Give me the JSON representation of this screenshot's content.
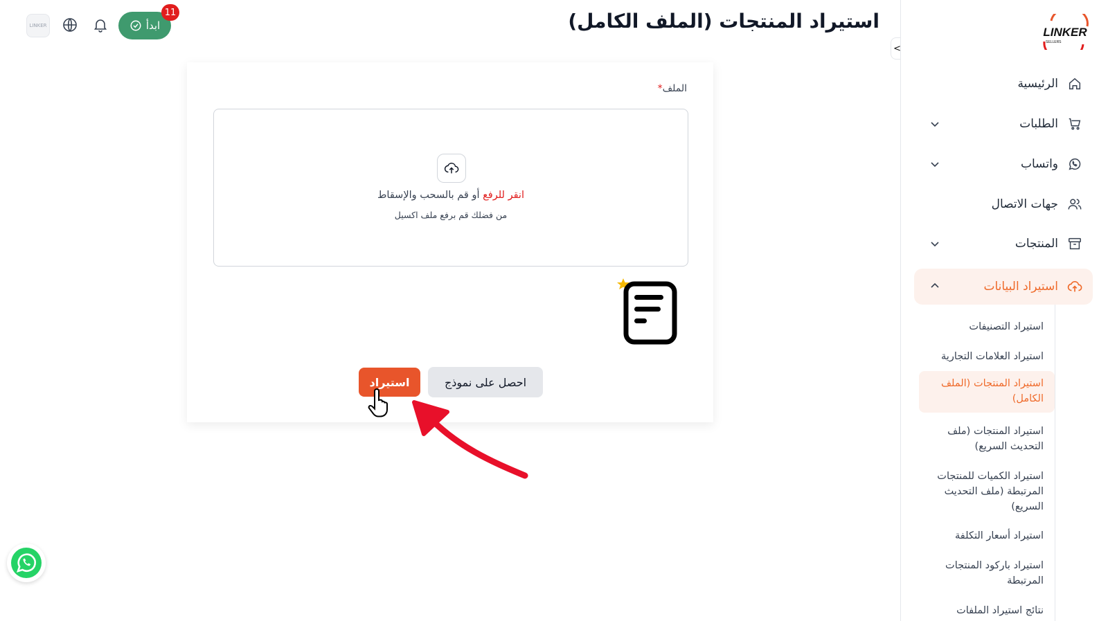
{
  "header": {
    "title": "استيراد المنتجات (الملف الكامل)",
    "start_label": "ابدأ",
    "notification_count": "11",
    "toggle_label": "<>"
  },
  "logo": {
    "text": "LINKER",
    "subtext": "SELLERS"
  },
  "avatar_text": "LINKER",
  "sidebar": {
    "items": [
      {
        "label": "الرئيسية",
        "icon": "home-icon"
      },
      {
        "label": "الطلبات",
        "icon": "cart-icon"
      },
      {
        "label": "واتساب",
        "icon": "whatsapp-icon"
      },
      {
        "label": "جهات الاتصال",
        "icon": "users-icon"
      },
      {
        "label": "المنتجات",
        "icon": "archive-icon"
      },
      {
        "label": "استيراد البيانات",
        "icon": "upload-cloud-icon"
      }
    ],
    "sub_items": [
      "استيراد التصنيفات",
      "استيراد العلامات التجارية",
      "استيراد المنتجات (الملف الكامل)",
      "استيراد المنتجات (ملف التحديث السريع)",
      "استيراد الكميات للمنتجات المرتبطة (ملف التحديث السريع)",
      "استيراد أسعار التكلفة",
      "استيراد باركود المنتجات المرتبطة",
      "نتائج استيراد الملفات"
    ]
  },
  "form": {
    "file_label": "الملف",
    "required_mark": "*",
    "click_to_upload": "انقر للرفع",
    "drag_drop": " أو قم بالسحب والإسقاط",
    "hint": "من فضلك قم برفع ملف اكسيل",
    "get_template_label": "احصل على نموذج",
    "import_label": "استيراد"
  },
  "colors": {
    "accent": "#ef6a2a",
    "import_button": "#e8552b",
    "start_button": "#3f9a6e",
    "badge": "#e11d1d",
    "arrow": "#e8102a"
  }
}
